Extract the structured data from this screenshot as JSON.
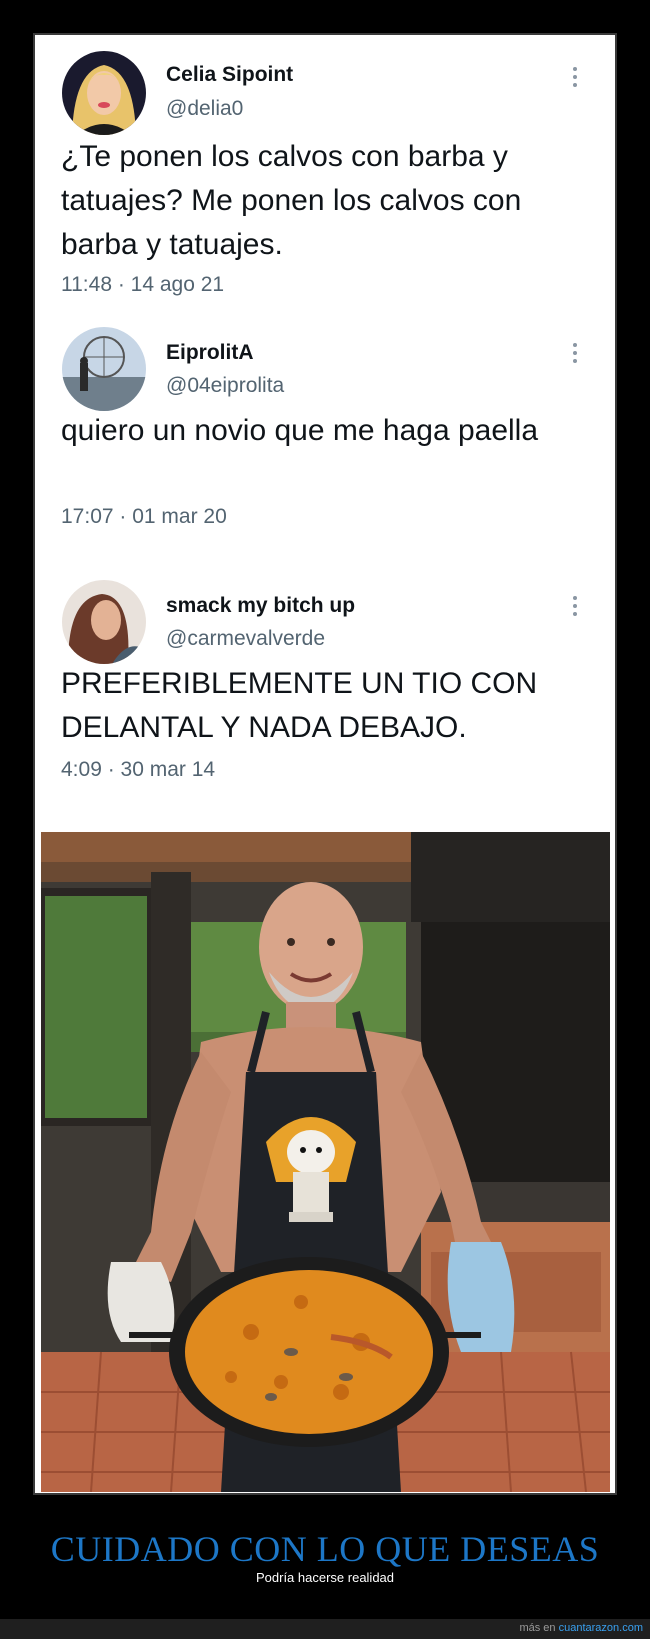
{
  "tweets": [
    {
      "name": "Celia Sipoint",
      "handle": "@delia0",
      "text": "¿Te ponen los calvos con barba y tatuajes? Me ponen los calvos con barba y tatuajes.",
      "time": "11:48 · 14 ago 21"
    },
    {
      "name": "EiprolitA",
      "handle": "@04eiprolita",
      "text": "quiero un novio que me haga paella",
      "time": "17:07 · 01 mar 20"
    },
    {
      "name": "smack my bitch up",
      "handle": "@carmevalverde",
      "text": "PREFERIBLEMENTE UN TIO CON DELANTAL Y NADA DEBAJO.",
      "time": "4:09 · 30 mar 14"
    }
  ],
  "caption": {
    "title": "CUIDADO CON LO QUE DESEAS",
    "subtitle": "Podría hacerse realidad"
  },
  "footer": {
    "prefix": "más en",
    "link": "cuantarazon.com"
  },
  "colors": {
    "caption": "#1d77c7",
    "link": "#39a0ef",
    "paella": "#e08a1e"
  }
}
